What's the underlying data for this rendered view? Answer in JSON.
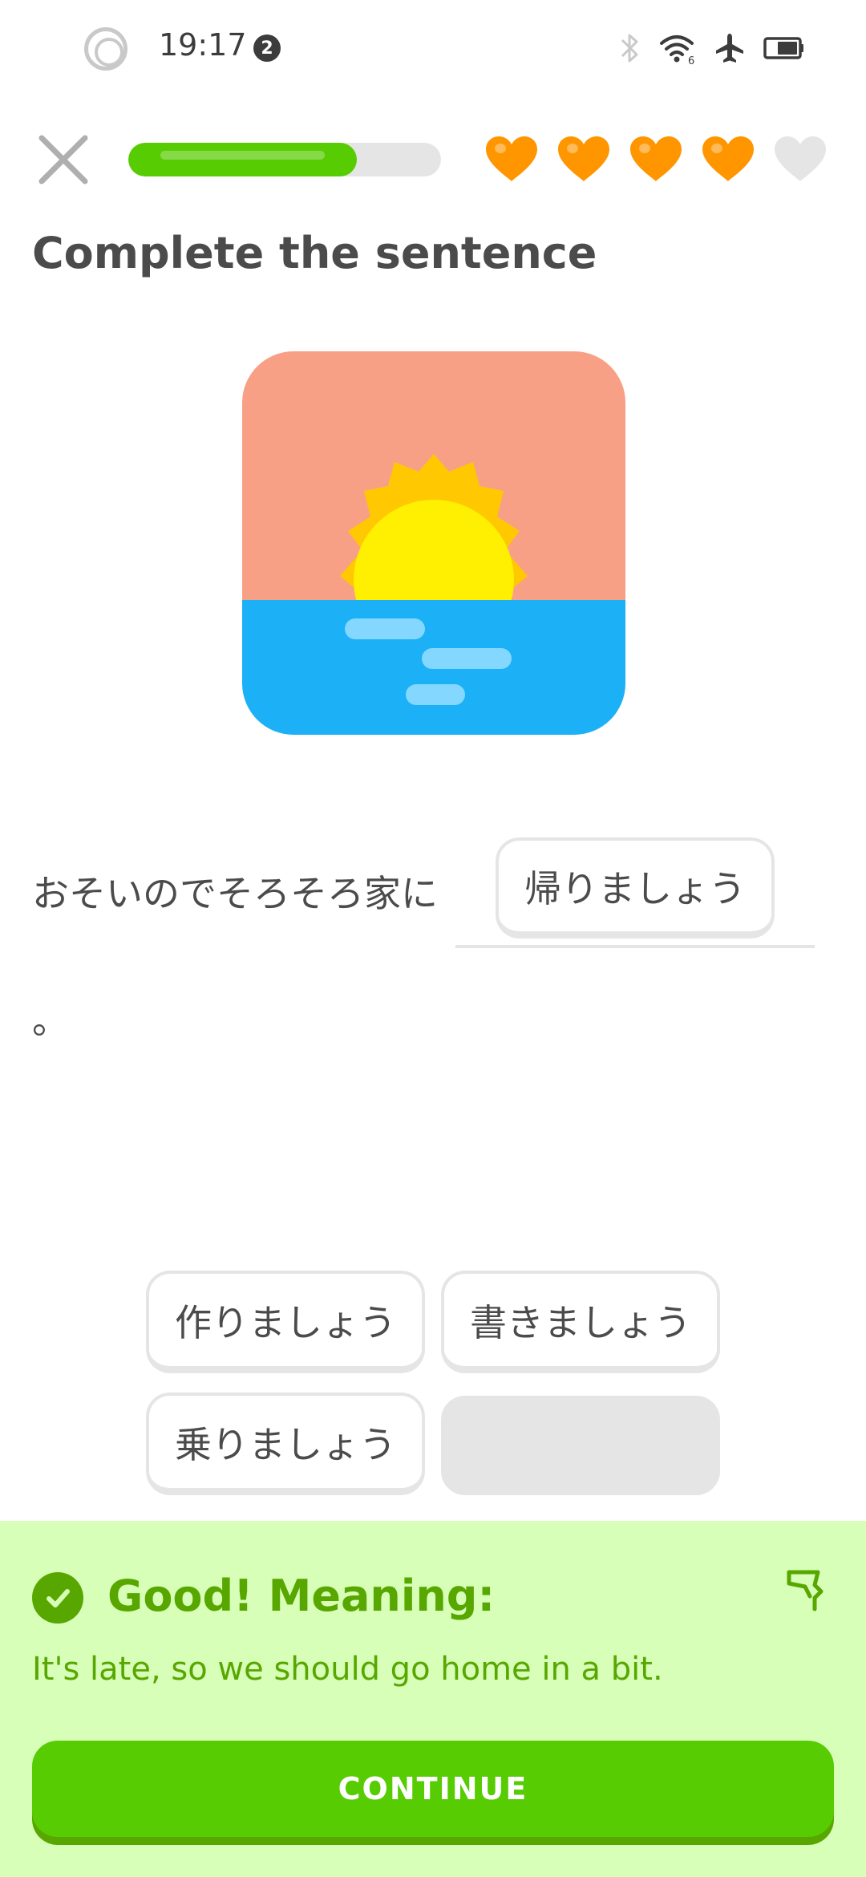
{
  "status_bar": {
    "time": "19:17",
    "notification_count": "2",
    "wifi_label": "6",
    "icons": [
      "bluetooth-icon",
      "wifi-icon",
      "airplane-icon",
      "battery-icon"
    ]
  },
  "header": {
    "close_icon": "close-icon",
    "progress": 0.73,
    "hearts_total": 5,
    "hearts_filled": 4,
    "heart_color": "#ff9600",
    "heart_empty_color": "#e5e5e5"
  },
  "exercise": {
    "title": "Complete the sentence",
    "illustration": "sunset-over-sea",
    "sentence_before": "おそいのでそろそろ家に",
    "answer": "帰りましょう",
    "sentence_after": "。"
  },
  "word_bank": {
    "options": [
      "作りましょう",
      "書きましょう",
      "乗りましょう"
    ]
  },
  "feedback": {
    "title": "Good! Meaning:",
    "text": "It's late, so we should go home in a bit.",
    "continue_label": "CONTINUE",
    "accent_color": "#58cc02",
    "text_color": "#58a700",
    "background": "#d7ffb8"
  }
}
